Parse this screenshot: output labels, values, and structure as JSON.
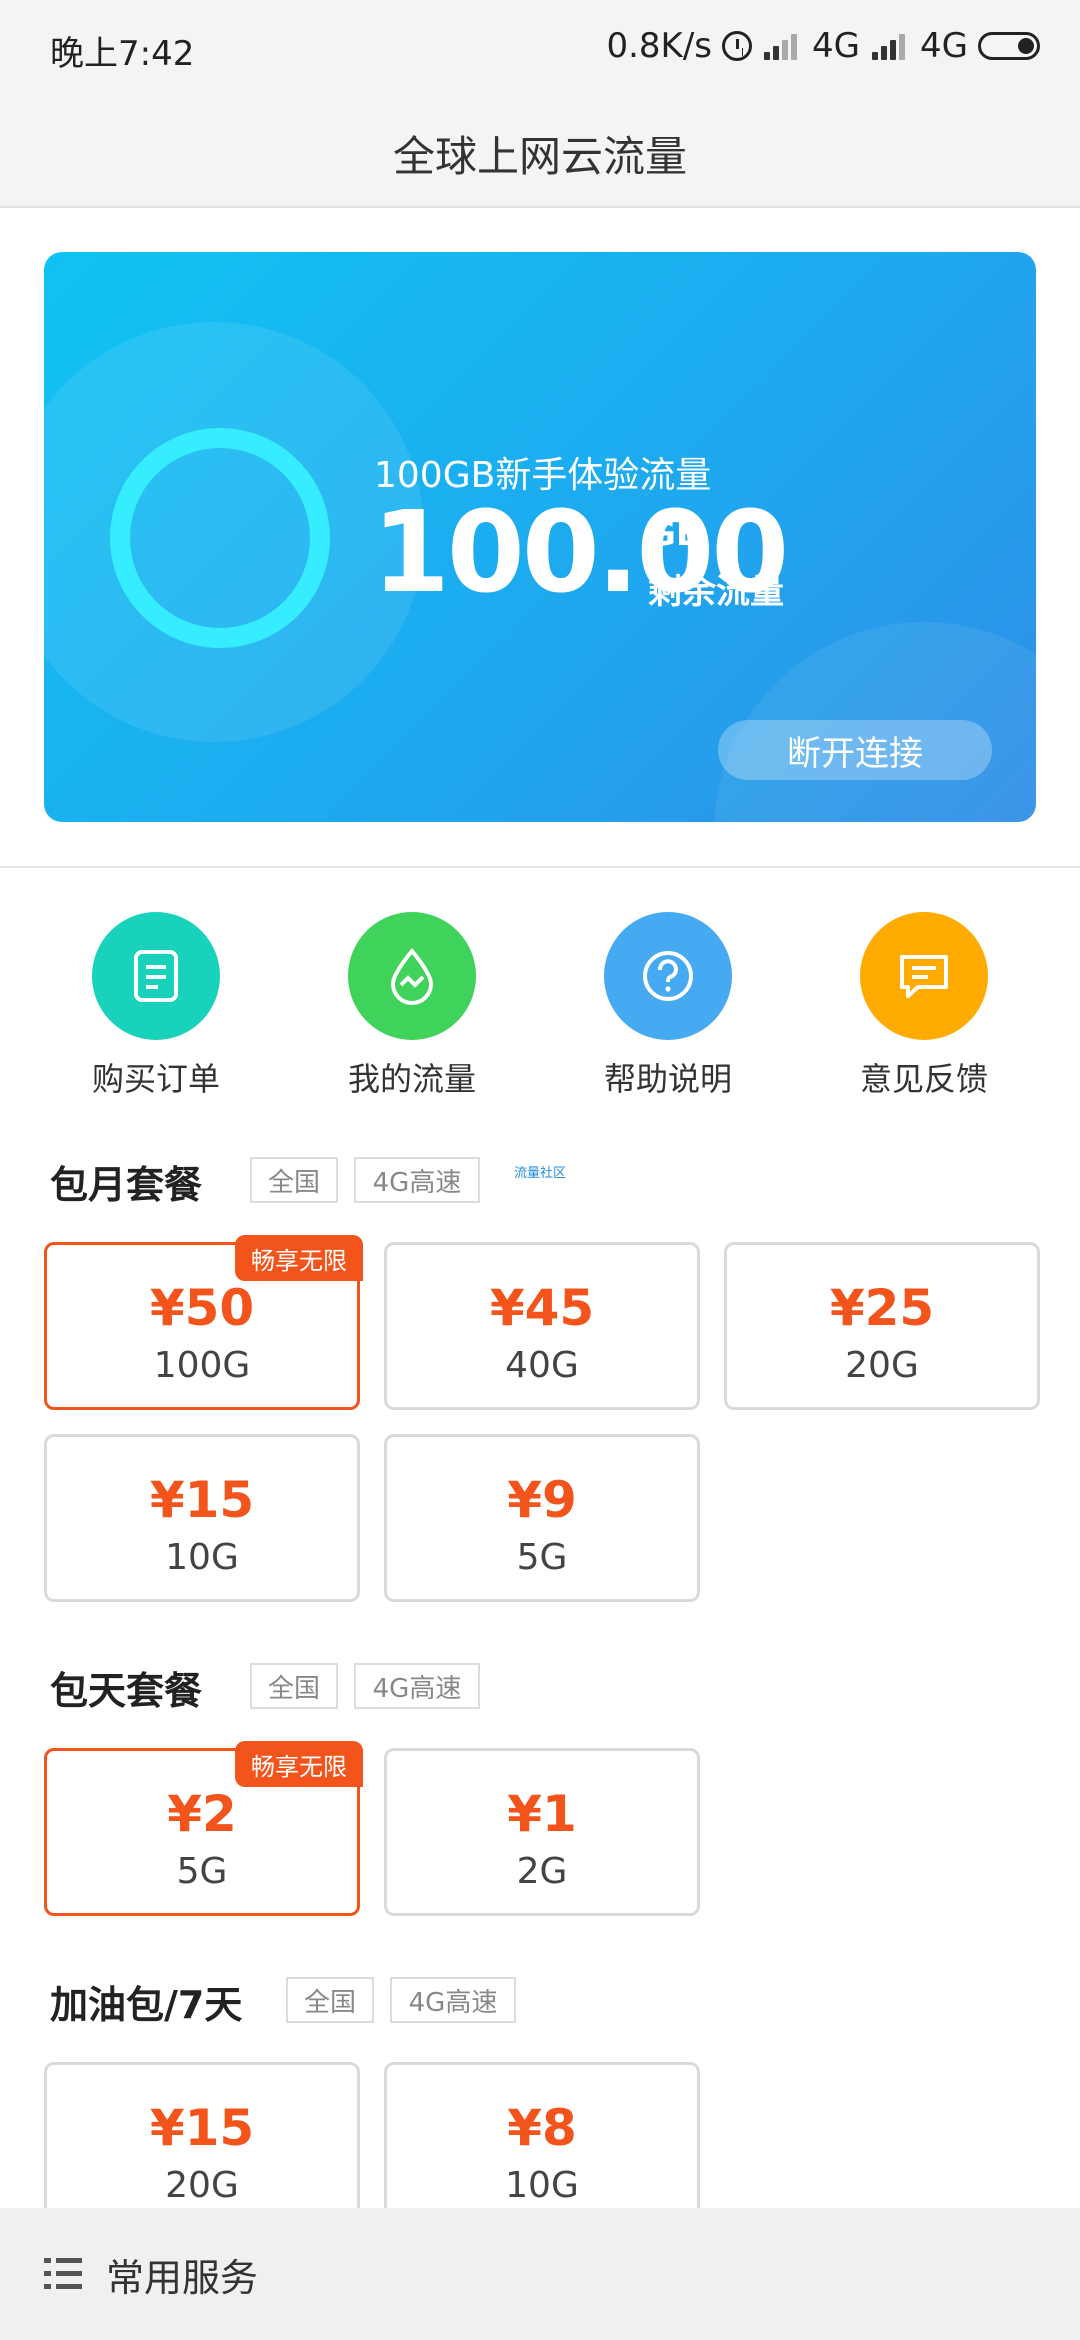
{
  "status_bar": {
    "time": "晚上7:42",
    "net_speed": "0.8K/s",
    "network1": "4G",
    "network2": "4G"
  },
  "header": {
    "title": "全球上网云流量"
  },
  "hero": {
    "plan_name": "100GB新手体验流量",
    "amount": "100.00",
    "unit": "GB",
    "remain_label": "剩余流量",
    "disconnect_label": "断开连接"
  },
  "shortcuts": [
    {
      "label": "购买订单",
      "icon": "order-icon",
      "color": "#18d2bb"
    },
    {
      "label": "我的流量",
      "icon": "data-drop-icon",
      "color": "#3fd35b"
    },
    {
      "label": "帮助说明",
      "icon": "help-icon",
      "color": "#45aaf2"
    },
    {
      "label": "意见反馈",
      "icon": "feedback-icon",
      "color": "#ffab00"
    }
  ],
  "sections": {
    "monthly": {
      "title": "包月套餐",
      "tags": [
        "全国",
        "4G高速"
      ],
      "link": "流量社区",
      "packages": [
        {
          "price": "¥50",
          "volume": "100G",
          "badge": "畅享无限"
        },
        {
          "price": "¥45",
          "volume": "40G"
        },
        {
          "price": "¥25",
          "volume": "20G"
        },
        {
          "price": "¥15",
          "volume": "10G"
        },
        {
          "price": "¥9",
          "volume": "5G"
        }
      ]
    },
    "daily": {
      "title": "包天套餐",
      "tags": [
        "全国",
        "4G高速"
      ],
      "packages": [
        {
          "price": "¥2",
          "volume": "5G",
          "badge": "畅享无限"
        },
        {
          "price": "¥1",
          "volume": "2G"
        }
      ]
    },
    "boost": {
      "title": "加油包/7天",
      "tags": [
        "全国",
        "4G高速"
      ],
      "packages": [
        {
          "price": "¥15",
          "volume": "20G"
        },
        {
          "price": "¥8",
          "volume": "10G"
        }
      ]
    }
  },
  "bottom_bar": {
    "label": "常用服务",
    "icon": "menu-list-icon"
  },
  "colors": {
    "accent": "#f2541b",
    "hero_start": "#10c3f3",
    "hero_end": "#2f8ee6",
    "ring": "#36ecff"
  }
}
